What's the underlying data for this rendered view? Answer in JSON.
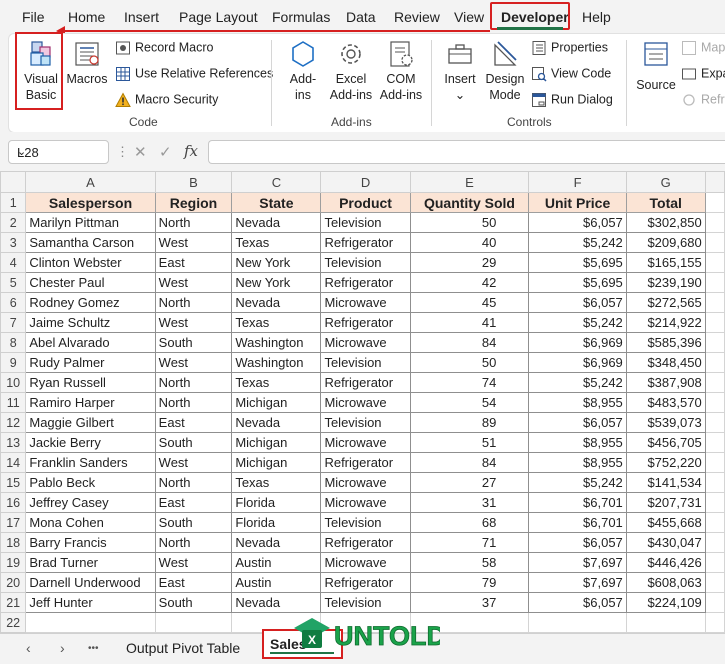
{
  "menu": {
    "items": [
      "File",
      "Home",
      "Insert",
      "Page Layout",
      "Formulas",
      "Data",
      "Review",
      "View",
      "Developer",
      "Help"
    ],
    "active": "Developer"
  },
  "ribbon": {
    "code": {
      "visual_basic": [
        "Visual",
        "Basic"
      ],
      "macros": "Macros",
      "record_macro": "Record Macro",
      "relative_refs": "Use Relative References",
      "macro_security": "Macro Security",
      "label": "Code"
    },
    "addins": {
      "addins": [
        "Add-",
        "ins"
      ],
      "excel_addins": [
        "Excel",
        "Add-ins"
      ],
      "com_addins": [
        "COM",
        "Add-ins"
      ],
      "label": "Add-ins"
    },
    "controls": {
      "insert": "Insert",
      "insert_arrow": "⌄",
      "design_mode": [
        "Design",
        "Mode"
      ],
      "properties": "Properties",
      "view_code": "View Code",
      "run_dialog": "Run Dialog",
      "label": "Controls"
    },
    "xml": {
      "source": "Source",
      "map": "Map",
      "expa": "Expa",
      "refr": "Refre"
    }
  },
  "formula_bar": {
    "name_box": "L28",
    "fx": "fx",
    "cancel": "✕",
    "enter": "✓",
    "value": ""
  },
  "columns": [
    "A",
    "B",
    "C",
    "D",
    "E",
    "F",
    "G"
  ],
  "headers": [
    "Salesperson",
    "Region",
    "State",
    "Product",
    "Quantity Sold",
    "Unit Price",
    "Total"
  ],
  "rows": [
    [
      "Marilyn Pittman",
      "North",
      "Nevada",
      "Television",
      "50",
      "$6,057",
      "$302,850"
    ],
    [
      "Samantha Carson",
      "West",
      "Texas",
      "Refrigerator",
      "40",
      "$5,242",
      "$209,680"
    ],
    [
      "Clinton Webster",
      "East",
      "New York",
      "Television",
      "29",
      "$5,695",
      "$165,155"
    ],
    [
      "Chester Paul",
      "West",
      "New York",
      "Refrigerator",
      "42",
      "$5,695",
      "$239,190"
    ],
    [
      "Rodney Gomez",
      "North",
      "Nevada",
      "Microwave",
      "45",
      "$6,057",
      "$272,565"
    ],
    [
      "Jaime Schultz",
      "West",
      "Texas",
      "Refrigerator",
      "41",
      "$5,242",
      "$214,922"
    ],
    [
      "Abel Alvarado",
      "South",
      "Washington",
      "Microwave",
      "84",
      "$6,969",
      "$585,396"
    ],
    [
      "Rudy Palmer",
      "West",
      "Washington",
      "Television",
      "50",
      "$6,969",
      "$348,450"
    ],
    [
      "Ryan Russell",
      "North",
      "Texas",
      "Refrigerator",
      "74",
      "$5,242",
      "$387,908"
    ],
    [
      "Ramiro Harper",
      "North",
      "Michigan",
      "Microwave",
      "54",
      "$8,955",
      "$483,570"
    ],
    [
      "Maggie Gilbert",
      "East",
      "Nevada",
      "Television",
      "89",
      "$6,057",
      "$539,073"
    ],
    [
      "Jackie Berry",
      "South",
      "Michigan",
      "Microwave",
      "51",
      "$8,955",
      "$456,705"
    ],
    [
      "Franklin Sanders",
      "West",
      "Michigan",
      "Refrigerator",
      "84",
      "$8,955",
      "$752,220"
    ],
    [
      "Pablo Beck",
      "North",
      "Texas",
      "Microwave",
      "27",
      "$5,242",
      "$141,534"
    ],
    [
      "Jeffrey Casey",
      "East",
      "Florida",
      "Microwave",
      "31",
      "$6,701",
      "$207,731"
    ],
    [
      "Mona Cohen",
      "South",
      "Florida",
      "Television",
      "68",
      "$6,701",
      "$455,668"
    ],
    [
      "Barry Francis",
      "North",
      "Nevada",
      "Refrigerator",
      "71",
      "$6,057",
      "$430,047"
    ],
    [
      "Brad Turner",
      "West",
      "Austin",
      "Microwave",
      "58",
      "$7,697",
      "$446,426"
    ],
    [
      "Darnell Underwood",
      "East",
      "Austin",
      "Refrigerator",
      "79",
      "$7,697",
      "$608,063"
    ],
    [
      "Jeff Hunter",
      "South",
      "Nevada",
      "Television",
      "37",
      "$6,057",
      "$224,109"
    ]
  ],
  "row_numbers": [
    "1",
    "2",
    "3",
    "4",
    "5",
    "6",
    "7",
    "8",
    "9",
    "10",
    "11",
    "12",
    "13",
    "14",
    "15",
    "16",
    "17",
    "18",
    "19",
    "20",
    "21",
    "22"
  ],
  "sheet_tabs": {
    "prev": "‹",
    "next": "›",
    "more": "•••",
    "tabs": [
      "Output Pivot Table",
      "Sales"
    ],
    "active": "Sales"
  },
  "watermark": "UNTOLD",
  "colors": {
    "accent_red": "#d62020",
    "excel_green": "#217346",
    "header_fill": "#fbe4d5"
  }
}
